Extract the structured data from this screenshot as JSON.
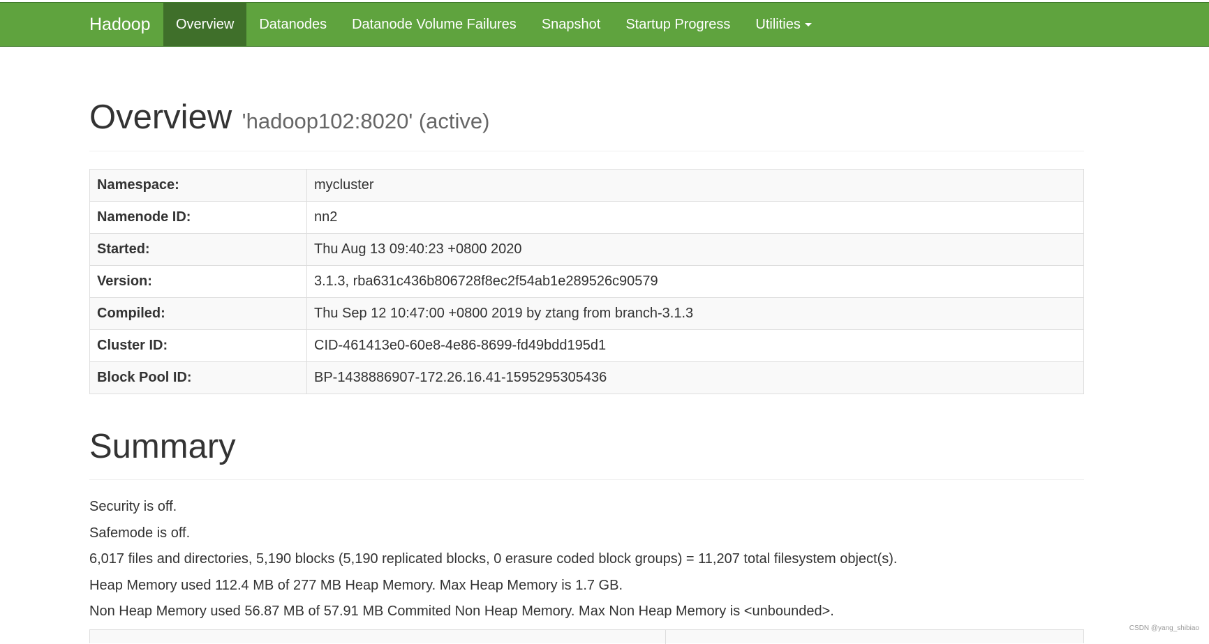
{
  "navbar": {
    "brand": "Hadoop",
    "items": [
      {
        "label": "Overview",
        "active": true
      },
      {
        "label": "Datanodes",
        "active": false
      },
      {
        "label": "Datanode Volume Failures",
        "active": false
      },
      {
        "label": "Snapshot",
        "active": false
      },
      {
        "label": "Startup Progress",
        "active": false
      },
      {
        "label": "Utilities",
        "active": false,
        "dropdown": true
      }
    ]
  },
  "overview": {
    "title": "Overview",
    "subtitle": "'hadoop102:8020' (active)",
    "rows": [
      {
        "key": "Namespace:",
        "value": "mycluster"
      },
      {
        "key": "Namenode ID:",
        "value": "nn2"
      },
      {
        "key": "Started:",
        "value": "Thu Aug 13 09:40:23 +0800 2020"
      },
      {
        "key": "Version:",
        "value": "3.1.3, rba631c436b806728f8ec2f54ab1e289526c90579"
      },
      {
        "key": "Compiled:",
        "value": "Thu Sep 12 10:47:00 +0800 2019 by ztang from branch-3.1.3"
      },
      {
        "key": "Cluster ID:",
        "value": "CID-461413e0-60e8-4e86-8699-fd49bdd195d1"
      },
      {
        "key": "Block Pool ID:",
        "value": "BP-1438886907-172.26.16.41-1595295305436"
      }
    ]
  },
  "summary": {
    "title": "Summary",
    "lines": [
      "Security is off.",
      "Safemode is off.",
      "6,017 files and directories, 5,190 blocks (5,190 replicated blocks, 0 erasure coded block groups) = 11,207 total filesystem object(s).",
      "Heap Memory used 112.4 MB of 277 MB Heap Memory. Max Heap Memory is 1.7 GB.",
      "Non Heap Memory used 56.87 MB of 57.91 MB Commited Non Heap Memory. Max Non Heap Memory is <unbounded>."
    ]
  },
  "watermark": "CSDN @yang_shibiao",
  "colors": {
    "navbar_bg": "#5fa33e",
    "navbar_active": "#3f6f2a"
  }
}
